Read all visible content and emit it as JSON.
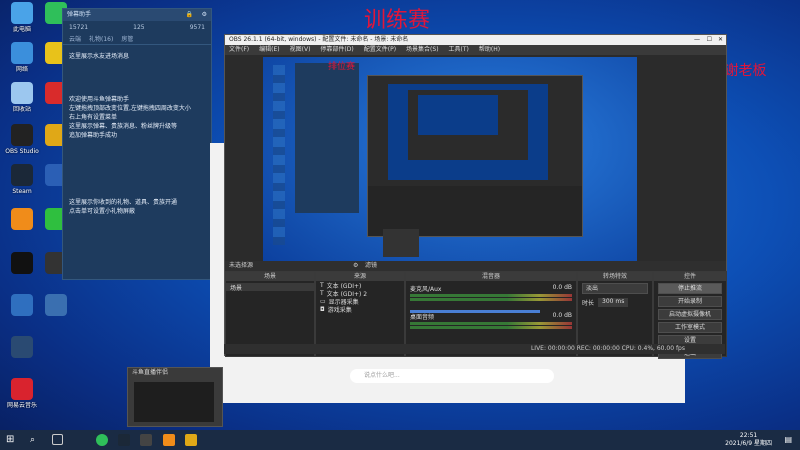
{
  "watermark": {
    "main": "训练赛",
    "thanks": "福星过一过 谢谢老板"
  },
  "desktop_icons": [
    {
      "label": "此电脑",
      "icon": "computer-icon",
      "color": "#4aa3e8"
    },
    {
      "label": "网络",
      "icon": "network-icon",
      "color": "#3b8fdc"
    },
    {
      "label": "回收站",
      "icon": "recycle-bin-icon",
      "color": "#9cc7ef"
    },
    {
      "label": "OBS Studio",
      "icon": "obs-icon",
      "color": "#222222"
    },
    {
      "label": "Steam",
      "icon": "steam-icon",
      "color": "#1b2838"
    },
    {
      "label": "",
      "icon": "app-orange-icon",
      "color": "#f08c1a"
    },
    {
      "label": "",
      "icon": "game-icon",
      "color": "#111111"
    },
    {
      "label": "",
      "icon": "app-blue-icon",
      "color": "#2f6fbf"
    },
    {
      "label": "",
      "icon": "shield-icon",
      "color": "#2a4a72"
    },
    {
      "label": "网易云音乐",
      "icon": "music-icon",
      "color": "#d9232e"
    },
    {
      "label": "",
      "icon": "browser-icon",
      "color": "#2fbf5a"
    },
    {
      "label": "",
      "icon": "chrome-icon",
      "color": "#e8c21a"
    },
    {
      "label": "",
      "icon": "app-red-icon",
      "color": "#d92b2b"
    },
    {
      "label": "",
      "icon": "app-yellow-icon",
      "color": "#e0a817"
    },
    {
      "label": "",
      "icon": "doc-icon",
      "color": "#2b5fb5"
    },
    {
      "label": "",
      "icon": "wechat-icon",
      "color": "#2fbf3f"
    },
    {
      "label": "",
      "icon": "app-dark-icon",
      "color": "#333333"
    },
    {
      "label": "",
      "icon": "app-arch-icon",
      "color": "#3a6fb0"
    }
  ],
  "danmu": {
    "header": "弹幕助手",
    "stats": [
      "15721",
      "125",
      "9571"
    ],
    "tabs": [
      "云端",
      "礼物(16)",
      "房管"
    ],
    "messages": [
      "这里展示水友进场消息",
      "欢迎使用斗鱼弹幕助手",
      "左键拖拽顶部改变位置,左键拖拽四周改变大小",
      "右上角有设置菜单",
      "这里展示弹幕、贵族消息、粉丝牌升级等",
      "追加弹幕助手成功",
      "这里展示你收到的礼物、道具、贵族开通",
      "点击单可设置小礼物屏蔽"
    ]
  },
  "obs": {
    "title": "OBS 26.1.1 (64-bit, windows) - 配置文件: 未命名 - 场景: 未命名",
    "menu": [
      "文件(F)",
      "编辑(E)",
      "视图(V)",
      "停靠部件(D)",
      "配置文件(P)",
      "场景集合(S)",
      "工具(T)",
      "帮助(H)"
    ],
    "preview_label": "排位赛",
    "status": "LIVE: 00:00:00   REC: 00:00:00   CPU: 0.4%, 60.00 fps",
    "docks": {
      "scenes": {
        "title": "场景",
        "items": [
          "场景"
        ]
      },
      "sources": {
        "title": "来源",
        "items": [
          "文本 (GDI+)",
          "文本 (GDI+) 2",
          "显示器采集",
          "游戏采集"
        ]
      },
      "mixer": {
        "title": "混音器",
        "channels": [
          {
            "name": "麦克风/Aux",
            "db": "0.0 dB"
          },
          {
            "name": "桌面音频",
            "db": "0.0 dB"
          }
        ]
      },
      "transitions": {
        "title": "转场特效",
        "type": "淡出",
        "duration_label": "时长",
        "duration": "300 ms"
      },
      "controls": {
        "title": "控件",
        "buttons": [
          "停止推流",
          "开始录制",
          "启动虚拟摄像机",
          "工作室模式",
          "设置",
          "退出"
        ]
      }
    },
    "filter_label": "滤镜",
    "no_source": "未选择源"
  },
  "chat": {
    "placeholder": "说点什么吧..."
  },
  "popup": {
    "title": "斗鱼直播伴侣"
  },
  "taskbar": {
    "time": "22:51",
    "date": "2021/6/9 星期四"
  }
}
